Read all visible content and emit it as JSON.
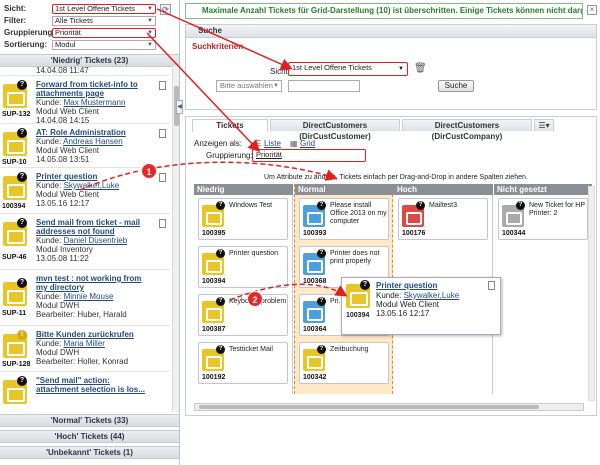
{
  "filters": {
    "sicht_label": "Sicht:",
    "sicht_value": "1st Level Offene Tickets",
    "filter_label": "Filter:",
    "filter_value": "Alle Tickets",
    "gruppierung_label": "Gruppierung:",
    "gruppierung_value": "Priorität",
    "sortierung_label": "Sortierung:",
    "sortierung_value": "Modul"
  },
  "groups": {
    "niedrig": "'Niedrig' Tickets (23)",
    "normal": "'Normal' Tickets (33)",
    "hoch": "'Hoch' Tickets (44)",
    "unbekannt": "'Unbekannt' Tickets (1)"
  },
  "tickets": [
    {
      "id": "",
      "title": "",
      "l1": "14.04.08 11:47",
      "l2": "",
      "l3": ""
    },
    {
      "id": "SUP-132",
      "title": "Forward from ticket-info to attachments page",
      "kunde": "Kunde:",
      "kunde_name": "Max Mustermann",
      "l2": "Modul  Web Client",
      "l3": "14.04.08 14:15"
    },
    {
      "id": "SUP-10",
      "title": "AT: Role Administration",
      "kunde": "Kunde:",
      "kunde_name": "Andreas Hansen",
      "l2": "Modul  Web Client",
      "l3": "14.05.08 13:51"
    },
    {
      "id": "100394",
      "title": "Printer question",
      "kunde": "Kunde:",
      "kunde_name": "Skywalker,Luke",
      "l2": "Modul  Web Client",
      "l3": "13.05.16 12:17"
    },
    {
      "id": "SUP-46",
      "title": "Send mail from ticket - mail addresses not found",
      "kunde": "Kunde:",
      "kunde_name": "Daniel Düsentrieb",
      "l2": "Modul  Inventory",
      "l3": "13.05.08 11:22"
    },
    {
      "id": "SUP-11",
      "title": "mvn test : not working from my directory",
      "kunde": "Kunde:",
      "kunde_name": "Minnie Mouse",
      "l2": "Modul  DWH",
      "l3": "Bearbeiter: Huber, Harald"
    },
    {
      "id": "SUP-128",
      "title": "Bitte Kunden zurückrufen",
      "kunde": "Kunde:",
      "kunde_name": "Maria Miller",
      "l2": "Modul  DWH",
      "l3": "Bearbeiter: Holler, Konrad"
    },
    {
      "id": "",
      "title": "\"Send mail\" action: attachment selection is los...",
      "kunde": "",
      "kunde_name": "",
      "l2": "",
      "l3": ""
    }
  ],
  "warning": "Maximale Anzahl Tickets für Grid-Darstellung (10) ist überschritten. Einige Tickets können nicht dargestellt werden",
  "search": {
    "header": "Suche",
    "criteria": "Suchkriterien",
    "sicht_label": "Sicht",
    "sicht_value": "1st Level Offene Tickets",
    "select_placeholder": "Bitte auswählen",
    "search_button": "Suche"
  },
  "tabs": [
    "Tickets",
    "DirectCustomers (DirCustCustomer)",
    "DirectCustomers (DirCustCompany)"
  ],
  "view": {
    "anzeigen_label": "Anzeigen als:",
    "liste": "Liste",
    "grid": "Grid",
    "gruppierung_label": "Gruppierung:",
    "gruppierung_value": "Priorität",
    "hint": "Um Attribute zu ändern, Tickets einfach per Drag-and-Drop in andere Spalten ziehen."
  },
  "columns": [
    "Niedrig",
    "Normal",
    "Hoch",
    "Nicht gesetzt"
  ],
  "cards": {
    "niedrig": [
      {
        "id": "100395",
        "text": "Windows Test",
        "color": "#e8c628"
      },
      {
        "id": "100394",
        "text": "Printer question",
        "color": "#e8c628"
      },
      {
        "id": "100387",
        "text": "Keyboard problem",
        "color": "#e8c628"
      },
      {
        "id": "100192",
        "text": "Testticket Mail",
        "color": "#e8c628"
      }
    ],
    "normal": [
      {
        "id": "100393",
        "text": "Please install Office 2013 on my computer",
        "color": "#4aa0dc"
      },
      {
        "id": "100368",
        "text": "Printer does not print properly",
        "color": "#4aa0dc"
      },
      {
        "id": "100364",
        "text": "Pri...",
        "color": "#4aa0dc"
      },
      {
        "id": "100342",
        "text": "Zeitbuchung",
        "color": "#e8c628"
      }
    ],
    "hoch": [
      {
        "id": "100176",
        "text": "Mailtest3",
        "color": "#e04848"
      }
    ],
    "nicht": [
      {
        "id": "100344",
        "text": "New Ticket for HP Printer: 2",
        "color": "#aaaaaa"
      }
    ]
  },
  "popup": {
    "id": "100394",
    "title": "Printer question",
    "kunde": "Kunde:",
    "kunde_name": "Skywalker,Luke",
    "l2": "Modul  Web Client",
    "l3": "13.05.16 12:17"
  },
  "badges": [
    "1",
    "2"
  ],
  "colors": {
    "accent_red": "#e02020",
    "warning_green": "#2a7a2a",
    "link_blue": "#234a80"
  }
}
